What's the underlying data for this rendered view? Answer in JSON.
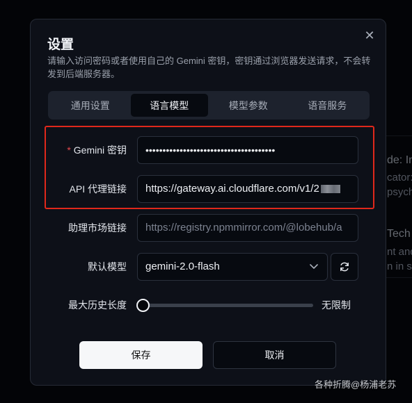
{
  "background": {
    "line1": "de: In",
    "line2": "cator:",
    "line3": "psych",
    "line4": "Tech",
    "line5": "nt and",
    "line6": "n in so"
  },
  "modal": {
    "title": "设置",
    "description": "请输入访问密码或者使用自己的 Gemini 密钥，密钥通过浏览器发送请求，不会转发到后端服务器。",
    "close_icon": "close-icon"
  },
  "tabs": [
    {
      "label": "通用设置",
      "active": false
    },
    {
      "label": "语言模型",
      "active": true
    },
    {
      "label": "模型参数",
      "active": false
    },
    {
      "label": "语音服务",
      "active": false
    }
  ],
  "form": {
    "api_key": {
      "required_mark": "*",
      "label": "Gemini 密钥",
      "value": "••••••••••••••••••••••••••••••••••••••"
    },
    "api_proxy": {
      "label": "API 代理链接",
      "value": "https://gateway.ai.cloudflare.com/v1/2"
    },
    "assistant_market": {
      "label": "助理市场链接",
      "placeholder": "https://registry.npmmirror.com/@lobehub/a"
    },
    "default_model": {
      "label": "默认模型",
      "value": "gemini-2.0-flash",
      "chevron_icon": "chevron-down-icon",
      "refresh_icon": "refresh-icon"
    },
    "max_history": {
      "label": "最大历史长度",
      "value_text": "无限制",
      "slider_fraction": 0
    }
  },
  "actions": {
    "save_label": "保存",
    "cancel_label": "取消"
  },
  "watermark": "各种折腾@杨浦老苏",
  "colors": {
    "highlight": "#e0281b",
    "required": "#e5484d",
    "primary_button": "#f6f7f9"
  }
}
